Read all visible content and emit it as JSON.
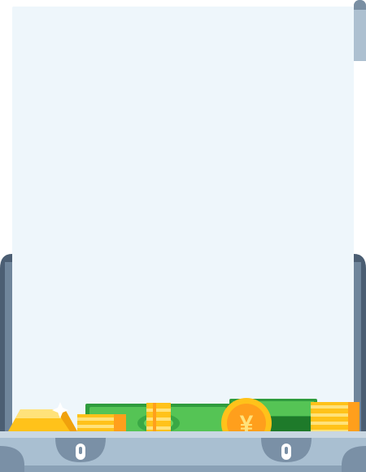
{
  "colors": {
    "panel": "#eef6fb",
    "case_frame": "#4b5e73",
    "case_body": "#a9bfd1",
    "case_trim": "#7a90a6",
    "cash_green": "#3fae49",
    "cash_light": "#78d36b",
    "gold": "#ffc21a",
    "gold_light": "#ffe27a",
    "coin_orange": "#ff9f1c"
  },
  "icons": {
    "suitcase": "suitcase-icon",
    "coin": "yen-coin-icon",
    "gold_bar": "gold-bar-icon",
    "banknote": "banknote-icon",
    "latch": "latch-icon"
  },
  "coin_symbol": "¥"
}
